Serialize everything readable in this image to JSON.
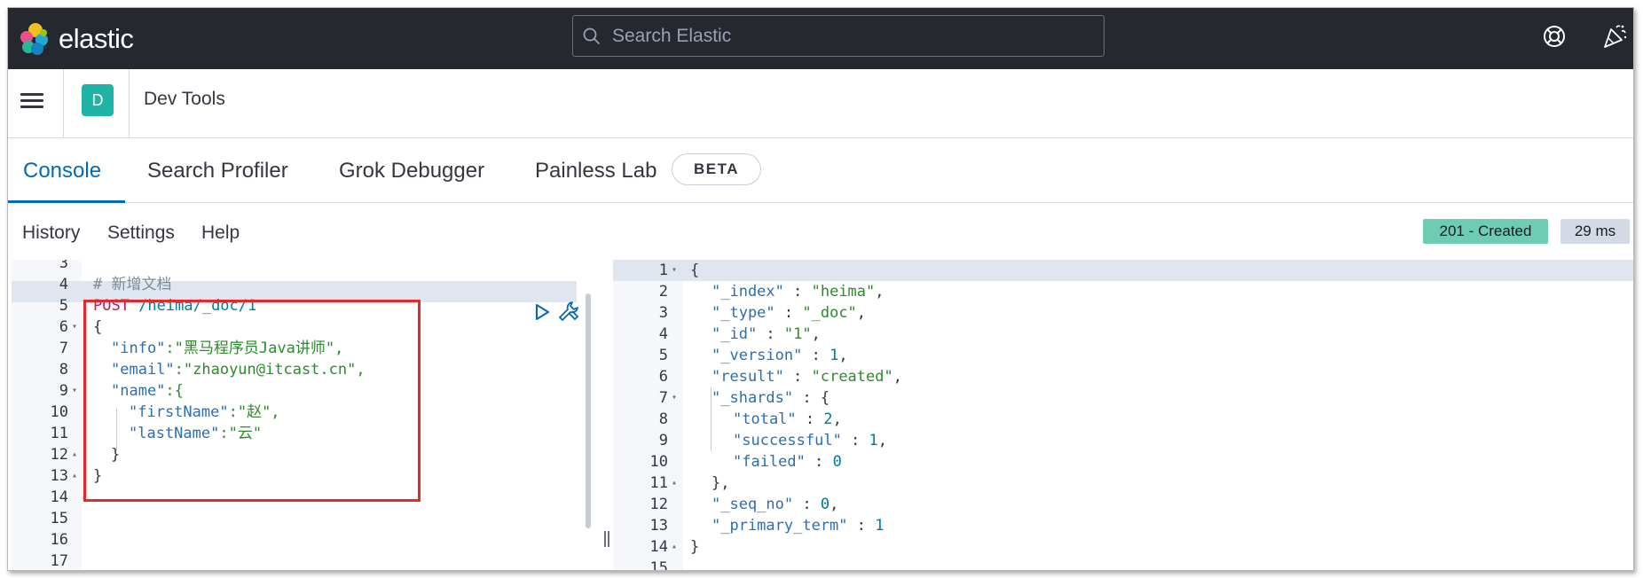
{
  "header": {
    "logo_text": "elastic",
    "search_placeholder": "Search Elastic"
  },
  "breadcrumb": {
    "space_initial": "D",
    "title": "Dev Tools"
  },
  "tabs": [
    {
      "label": "Console",
      "active": true
    },
    {
      "label": "Search Profiler",
      "active": false
    },
    {
      "label": "Grok Debugger",
      "active": false
    },
    {
      "label": "Painless Lab",
      "active": false
    }
  ],
  "beta_badge": "BETA",
  "subnav": {
    "history": "History",
    "settings": "Settings",
    "help": "Help"
  },
  "response_status": {
    "status": "201 - Created",
    "timing": "29 ms",
    "status_color": "#6dccb1"
  },
  "request_editor": {
    "lines": [
      {
        "num": "3",
        "fold": "",
        "text": ""
      },
      {
        "num": "4",
        "fold": "",
        "text": "# 新增文档"
      },
      {
        "num": "5",
        "fold": "",
        "method": "POST",
        "text": " /heima/_doc/1"
      },
      {
        "num": "6",
        "fold": "▾",
        "text": "{"
      },
      {
        "num": "7",
        "fold": "",
        "key": "\"info\"",
        "text": ":\"黑马程序员Java讲师\","
      },
      {
        "num": "8",
        "fold": "",
        "key": "\"email\"",
        "text": ":\"zhaoyun@itcast.cn\","
      },
      {
        "num": "9",
        "fold": "▾",
        "key": "\"name\"",
        "text": ":{"
      },
      {
        "num": "10",
        "fold": "",
        "key": "\"firstName\"",
        "text": ":\"赵\","
      },
      {
        "num": "11",
        "fold": "",
        "key": "\"lastName\"",
        "text": ":\"云\""
      },
      {
        "num": "12",
        "fold": "▴",
        "text": "}"
      },
      {
        "num": "13",
        "fold": "▴",
        "text": "}"
      },
      {
        "num": "14",
        "fold": "",
        "text": ""
      },
      {
        "num": "15",
        "fold": "",
        "text": ""
      },
      {
        "num": "16",
        "fold": "",
        "text": ""
      },
      {
        "num": "17",
        "fold": "",
        "text": ""
      }
    ]
  },
  "response_editor": {
    "lines": [
      {
        "num": "1",
        "fold": "▾",
        "text": "{"
      },
      {
        "num": "2",
        "fold": "",
        "key": "\"_index\"",
        "sep": " : ",
        "val": "\"heima\"",
        "tail": ","
      },
      {
        "num": "3",
        "fold": "",
        "key": "\"_type\"",
        "sep": " : ",
        "val": "\"_doc\"",
        "tail": ","
      },
      {
        "num": "4",
        "fold": "",
        "key": "\"_id\"",
        "sep": " : ",
        "val": "\"1\"",
        "tail": ","
      },
      {
        "num": "5",
        "fold": "",
        "key": "\"_version\"",
        "sep": " : ",
        "num_val": "1",
        "tail": ","
      },
      {
        "num": "6",
        "fold": "",
        "key": "\"result\"",
        "sep": " : ",
        "val": "\"created\"",
        "tail": ","
      },
      {
        "num": "7",
        "fold": "▾",
        "key": "\"_shards\"",
        "sep": " : ",
        "tail": "{"
      },
      {
        "num": "8",
        "fold": "",
        "key": "\"total\"",
        "sep": " : ",
        "num_val": "2",
        "tail": ","
      },
      {
        "num": "9",
        "fold": "",
        "key": "\"successful\"",
        "sep": " : ",
        "num_val": "1",
        "tail": ","
      },
      {
        "num": "10",
        "fold": "",
        "key": "\"failed\"",
        "sep": " : ",
        "num_val": "0",
        "tail": ""
      },
      {
        "num": "11",
        "fold": "▴",
        "text": "},"
      },
      {
        "num": "12",
        "fold": "",
        "key": "\"_seq_no\"",
        "sep": " : ",
        "num_val": "0",
        "tail": ","
      },
      {
        "num": "13",
        "fold": "",
        "key": "\"_primary_term\"",
        "sep": " : ",
        "num_val": "1",
        "tail": ""
      },
      {
        "num": "14",
        "fold": "▴",
        "text": "}"
      },
      {
        "num": "15",
        "fold": "",
        "text": ""
      }
    ]
  }
}
